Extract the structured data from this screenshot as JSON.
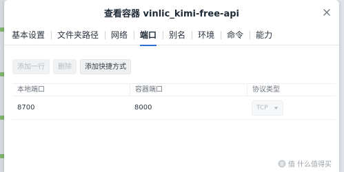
{
  "window": {
    "title": "查看容器 vinlic_kimi-free-api"
  },
  "tabs": [
    {
      "label": "基本设置",
      "active": false
    },
    {
      "label": "文件夹路径",
      "active": false
    },
    {
      "label": "网络",
      "active": false
    },
    {
      "label": "端口",
      "active": true
    },
    {
      "label": "别名",
      "active": false
    },
    {
      "label": "环境",
      "active": false
    },
    {
      "label": "命令",
      "active": false
    },
    {
      "label": "能力",
      "active": false
    }
  ],
  "toolbar": {
    "add_row": "添加一行",
    "delete": "删除",
    "add_shortcut": "添加快捷方式"
  },
  "ports_table": {
    "headers": [
      "本地端口",
      "容器端口",
      "协议类型"
    ],
    "rows": [
      {
        "local_port": "8700",
        "container_port": "8000",
        "protocol": "TCP"
      }
    ]
  },
  "watermark": {
    "text": "值 什么值得买"
  },
  "colors": {
    "accent": "#2d6fd2",
    "disabled_text": "#b7bcc2"
  },
  "icons": {
    "close": "close-icon",
    "dropdown": "chevron-down-icon",
    "watermark_logo": "zhi-logo-icon"
  }
}
